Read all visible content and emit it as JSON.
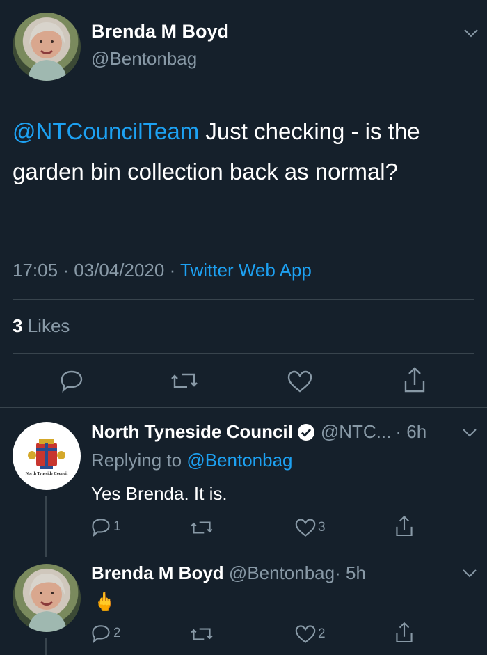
{
  "main_tweet": {
    "author_name": "Brenda M Boyd",
    "author_handle": "@Bentonbag",
    "mention": "@NTCouncilTeam",
    "text": " Just checking - is the garden bin collection back as normal?",
    "time": "17:05",
    "date": "03/04/2020",
    "source": "Twitter Web App",
    "likes_count": "3",
    "likes_label": "Likes"
  },
  "reply_1": {
    "author_name": "North Tyneside Council",
    "author_handle": "@NTC...",
    "time_ago": "· 6h",
    "replying_label": "Replying to",
    "replying_handle": "@Bentonbag",
    "text": "Yes Brenda. It is.",
    "logo_text": "North Tyneside Council",
    "replies": "1",
    "likes": "3"
  },
  "reply_2": {
    "author_name": "Brenda M Boyd",
    "author_handle": "@Bentonbag",
    "time_ago": "· 5h",
    "text": "🖕",
    "replies": "2",
    "likes": "2"
  },
  "colors": {
    "background": "#15202b",
    "accent": "#1da1f2",
    "muted": "#8899a6",
    "divider": "#38444d"
  },
  "icons": [
    "chevron-down-icon",
    "reply-icon",
    "retweet-icon",
    "like-icon",
    "share-icon",
    "verified-icon"
  ]
}
